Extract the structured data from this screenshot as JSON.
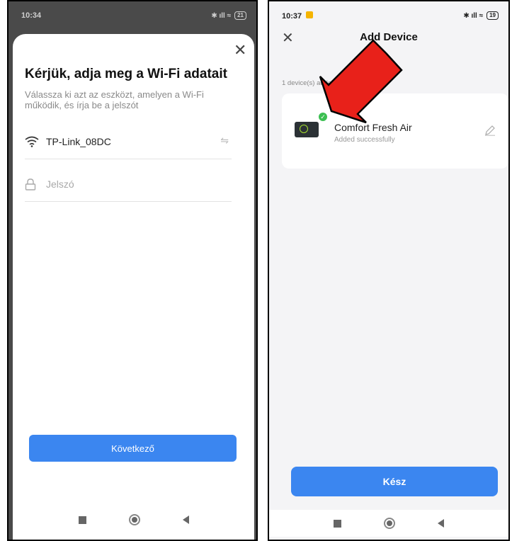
{
  "left_screen": {
    "status": {
      "time": "10:34",
      "battery": "21"
    },
    "title": "Kérjük, adja meg a Wi-Fi adatait",
    "subtitle": "Válassza ki azt az eszközt, amelyen a Wi-Fi működik, és írja be a jelszót",
    "wifi_name": "TP-Link_08DC",
    "password_placeholder": "Jelszó",
    "next_button": "Következő"
  },
  "right_screen": {
    "status": {
      "time": "10:37",
      "battery": "19"
    },
    "title": "Add Device",
    "added_count": "1 device(s) added successfully",
    "device": {
      "name": "Comfort  Fresh Air",
      "status": "Added successfully"
    },
    "done_button": "Kész"
  },
  "annotation": {
    "arrow_color": "#e8211a"
  },
  "colors": {
    "primary": "#3b86f0",
    "success": "#3cbf52"
  }
}
